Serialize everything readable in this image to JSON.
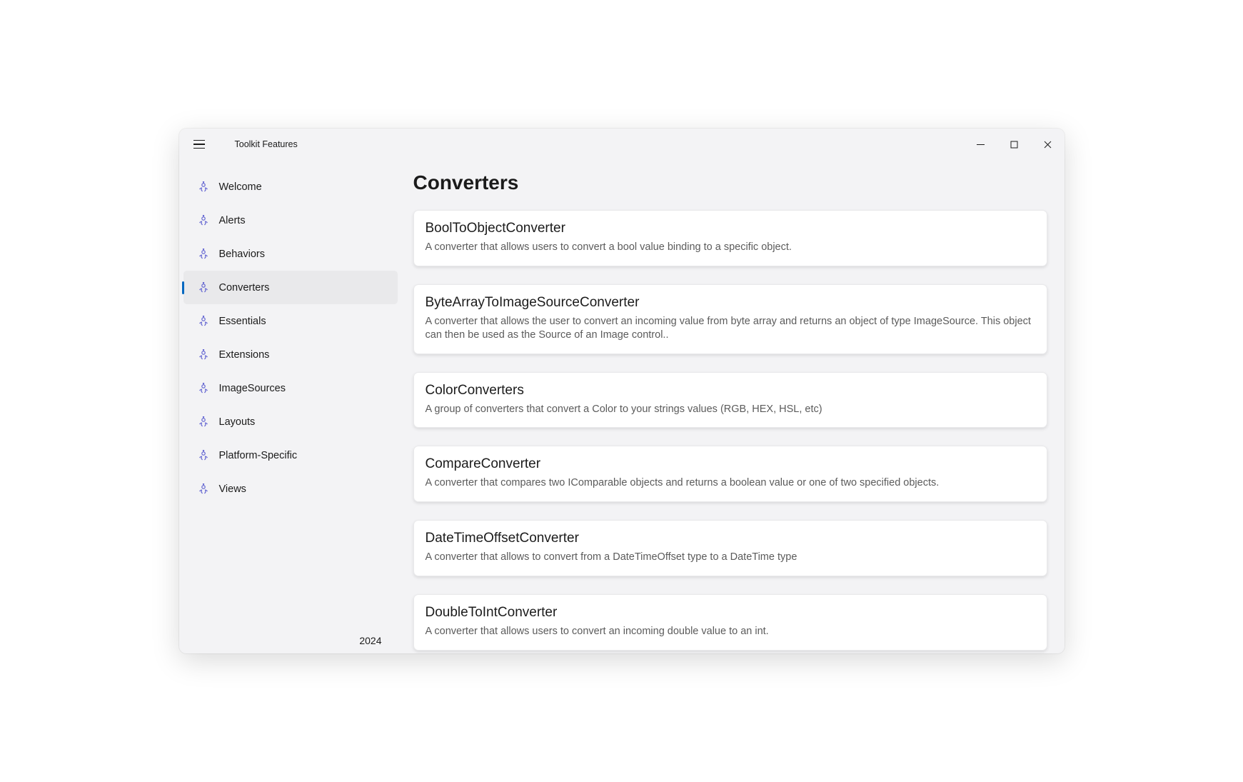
{
  "window": {
    "title": "Toolkit Features"
  },
  "sidebar": {
    "items": [
      {
        "label": "Welcome",
        "selected": false
      },
      {
        "label": "Alerts",
        "selected": false
      },
      {
        "label": "Behaviors",
        "selected": false
      },
      {
        "label": "Converters",
        "selected": true
      },
      {
        "label": "Essentials",
        "selected": false
      },
      {
        "label": "Extensions",
        "selected": false
      },
      {
        "label": "ImageSources",
        "selected": false
      },
      {
        "label": "Layouts",
        "selected": false
      },
      {
        "label": "Platform-Specific",
        "selected": false
      },
      {
        "label": "Views",
        "selected": false
      }
    ],
    "footer": "2024"
  },
  "page": {
    "title": "Converters"
  },
  "cards": [
    {
      "title": "BoolToObjectConverter",
      "desc": "A converter that allows users to convert a bool value binding to a specific object."
    },
    {
      "title": "ByteArrayToImageSourceConverter",
      "desc": "A converter that allows the user to convert an incoming value from byte array and returns an object of type ImageSource. This object can then be used as the Source of an Image control.."
    },
    {
      "title": "ColorConverters",
      "desc": "A group of converters that convert a Color to your strings values (RGB, HEX, HSL, etc)"
    },
    {
      "title": "CompareConverter",
      "desc": "A converter that compares two IComparable objects and returns a boolean value or one of two specified objects."
    },
    {
      "title": "DateTimeOffsetConverter",
      "desc": "A converter that allows to convert from a DateTimeOffset type to a DateTime type"
    },
    {
      "title": "DoubleToIntConverter",
      "desc": "A converter that allows users to convert an incoming double value to an int."
    }
  ]
}
